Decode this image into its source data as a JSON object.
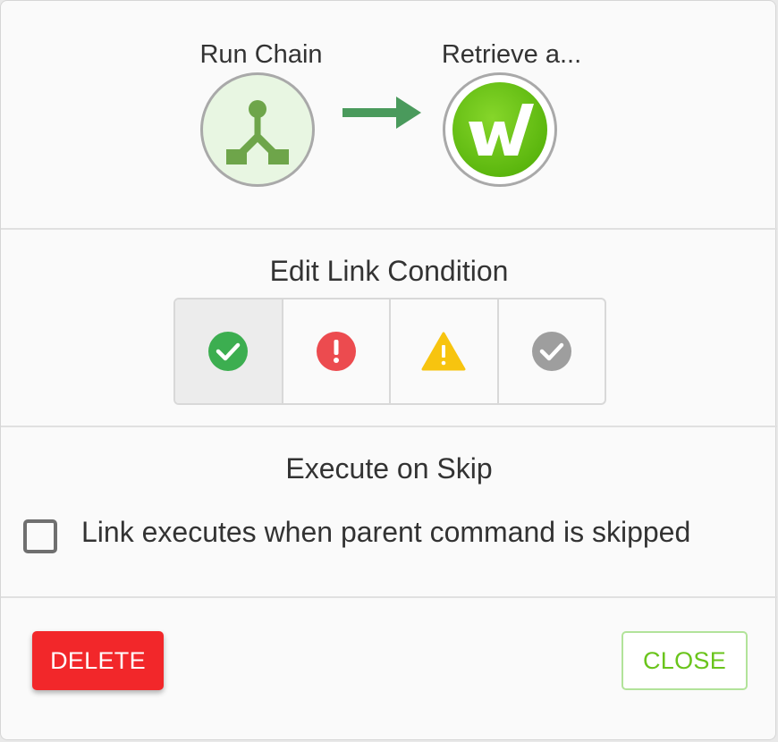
{
  "chain": {
    "source_node": {
      "label": "Run Chain",
      "icon": "chain-branch-icon"
    },
    "target_node": {
      "label": "Retrieve a...",
      "icon": "w-logo-icon"
    },
    "link_icon": "right-arrow-icon"
  },
  "link_condition": {
    "title": "Edit Link Condition",
    "options": [
      {
        "icon": "success-check-icon",
        "color": "#3cae50",
        "selected": true
      },
      {
        "icon": "error-exclamation-icon",
        "color": "#ec4b4f",
        "selected": false
      },
      {
        "icon": "warning-triangle-icon",
        "color": "#f7c40f",
        "selected": false
      },
      {
        "icon": "complete-check-icon",
        "color": "#9e9e9e",
        "selected": false
      }
    ]
  },
  "execute_on_skip": {
    "title": "Execute on Skip",
    "checkbox_label": "Link executes when parent command is skipped",
    "checked": false
  },
  "footer": {
    "delete_label": "DELETE",
    "close_label": "CLOSE"
  },
  "colors": {
    "delete": "#f2272a",
    "close_text": "#6ac41c",
    "arrow": "#4a9a5c",
    "node_brand": "#6ac41c"
  }
}
